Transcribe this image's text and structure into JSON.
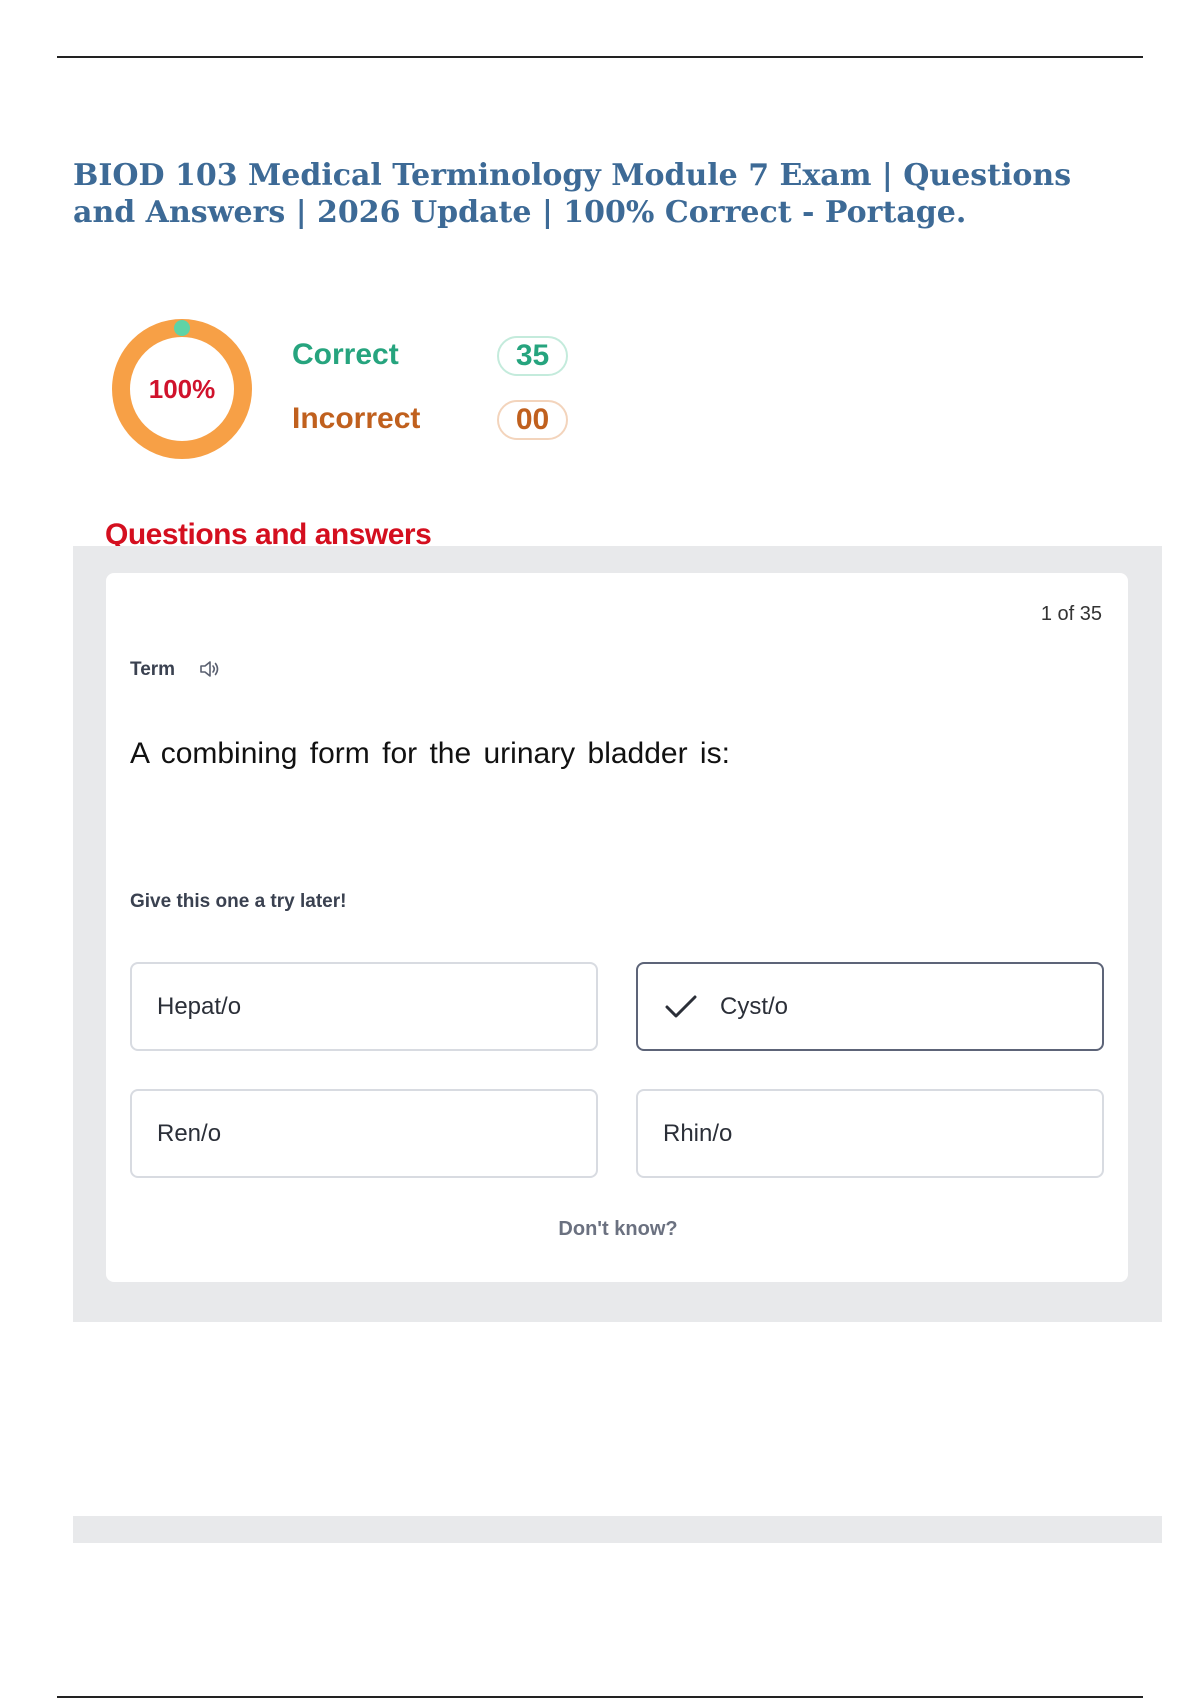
{
  "document": {
    "title": "BIOD 103 Medical Terminology Module 7 Exam | Questions and Answers | 2026 Update | 100% Correct - Portage."
  },
  "score": {
    "percent_label": "100%",
    "percent_value": 100,
    "correct_label": "Correct",
    "correct_count": "35",
    "incorrect_label": "Incorrect",
    "incorrect_count": "00",
    "colors": {
      "ring": "#f7a046",
      "ring_marker": "#5fd3a6",
      "correct": "#26a47e",
      "incorrect": "#c0601e",
      "percent_text": "#d0122c"
    }
  },
  "section": {
    "heading": "Questions and answers"
  },
  "card": {
    "counter": "1 of 35",
    "term_label": "Term",
    "term_audio_icon": "speaker-icon",
    "question": "A combining form for the urinary bladder is:",
    "try_later": "Give this one a try later!",
    "options": [
      {
        "label": "Hepat/o",
        "selected": false
      },
      {
        "label": "Cyst/o",
        "selected": true,
        "icon": "checkmark-icon"
      },
      {
        "label": "Ren/o",
        "selected": false
      },
      {
        "label": "Rhin/o",
        "selected": false
      }
    ],
    "dont_know": "Don't know?"
  }
}
